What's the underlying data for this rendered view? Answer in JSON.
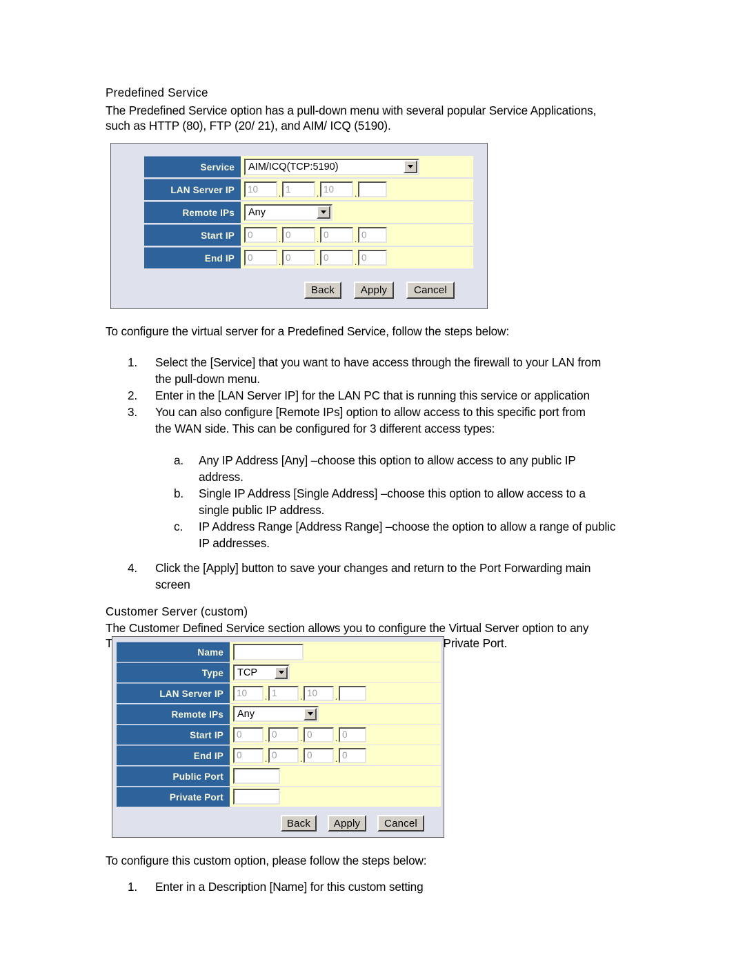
{
  "sections": {
    "predefined_heading": "Predefined Service",
    "predefined_intro_line1": "The Predefined Service option has a pull-down menu with several popular Service Applications,",
    "predefined_intro_line2": "such as HTTP (80), FTP (20/ 21), and AIM/ ICQ (5190).",
    "predefined_steps_intro": "To configure the virtual server for a Predefined Service, follow the steps below:",
    "custom_heading": "Customer Server (custom)",
    "custom_intro_line1": "The Customer Defined Service section allows you to configure the Virtual Server option to any",
    "custom_intro_line2": "Traffic type (TCP/ UDP/ TCP and UDP), any Public Port, and any Private Port.",
    "custom_steps_intro": "To configure this custom option, please follow the steps below:"
  },
  "predefined_steps": [
    {
      "marker": "1.",
      "line1": "Select the [Service] that you want to have access through the firewall to your LAN from",
      "line2": "the pull-down menu."
    },
    {
      "marker": "2.",
      "line1": "Enter in the [LAN Server IP] for the LAN PC that is running this service or application",
      "line2": ""
    },
    {
      "marker": "3.",
      "line1": "You can also configure [Remote IPs] option to allow access to this specific port from",
      "line2": "the WAN side.  This can be configured for 3 different access types:"
    }
  ],
  "predefined_substeps": [
    {
      "marker": "a.",
      "line1": "Any IP Address [Any] –choose this option to allow access to any public IP",
      "line2": "address."
    },
    {
      "marker": "b.",
      "line1": "Single IP Address [Single Address] –choose this option to allow access to a",
      "line2": "single public IP address."
    },
    {
      "marker": "c.",
      "line1": "IP Address Range [Address Range] –choose the option to allow a range of public",
      "line2": "IP addresses."
    }
  ],
  "predefined_step4": {
    "marker": "4.",
    "line1": "Click the [Apply] button to save your changes and return to the Port Forwarding main",
    "line2": "screen"
  },
  "custom_steps": [
    {
      "marker": "1.",
      "line1": "Enter in a Description [Name] for this custom setting",
      "line2": ""
    }
  ],
  "panel_predefined": {
    "rows": {
      "service_label": "Service",
      "lan_server_ip_label": "LAN Server IP",
      "remote_ips_label": "Remote IPs",
      "start_ip_label": "Start IP",
      "end_ip_label": "End IP"
    },
    "service_value": "AIM/ICQ(TCP:5190)",
    "remote_ips_value": "Any",
    "lan_server_ip": [
      "10",
      "1",
      "10",
      ""
    ],
    "start_ip": [
      "0",
      "0",
      "0",
      "0"
    ],
    "end_ip": [
      "0",
      "0",
      "0",
      "0"
    ],
    "buttons": {
      "back": "Back",
      "apply": "Apply",
      "cancel": "Cancel"
    }
  },
  "panel_custom": {
    "rows": {
      "name_label": "Name",
      "type_label": "Type",
      "lan_server_ip_label": "LAN Server IP",
      "remote_ips_label": "Remote IPs",
      "start_ip_label": "Start IP",
      "end_ip_label": "End IP",
      "public_port_label": "Public Port",
      "private_port_label": "Private Port"
    },
    "name_value": "",
    "type_value": "TCP",
    "remote_ips_value": "Any",
    "lan_server_ip": [
      "10",
      "1",
      "10",
      ""
    ],
    "start_ip": [
      "0",
      "0",
      "0",
      "0"
    ],
    "end_ip": [
      "0",
      "0",
      "0",
      "0"
    ],
    "public_port_value": "",
    "private_port_value": "",
    "buttons": {
      "back": "Back",
      "apply": "Apply",
      "cancel": "Cancel"
    }
  },
  "colors": {
    "label_blue": "#2e629b",
    "field_yellow": "#ffffcc",
    "panel_bg": "#dfe1ec",
    "button_face": "#d4d0c8",
    "label_text": "#f7f7da"
  }
}
